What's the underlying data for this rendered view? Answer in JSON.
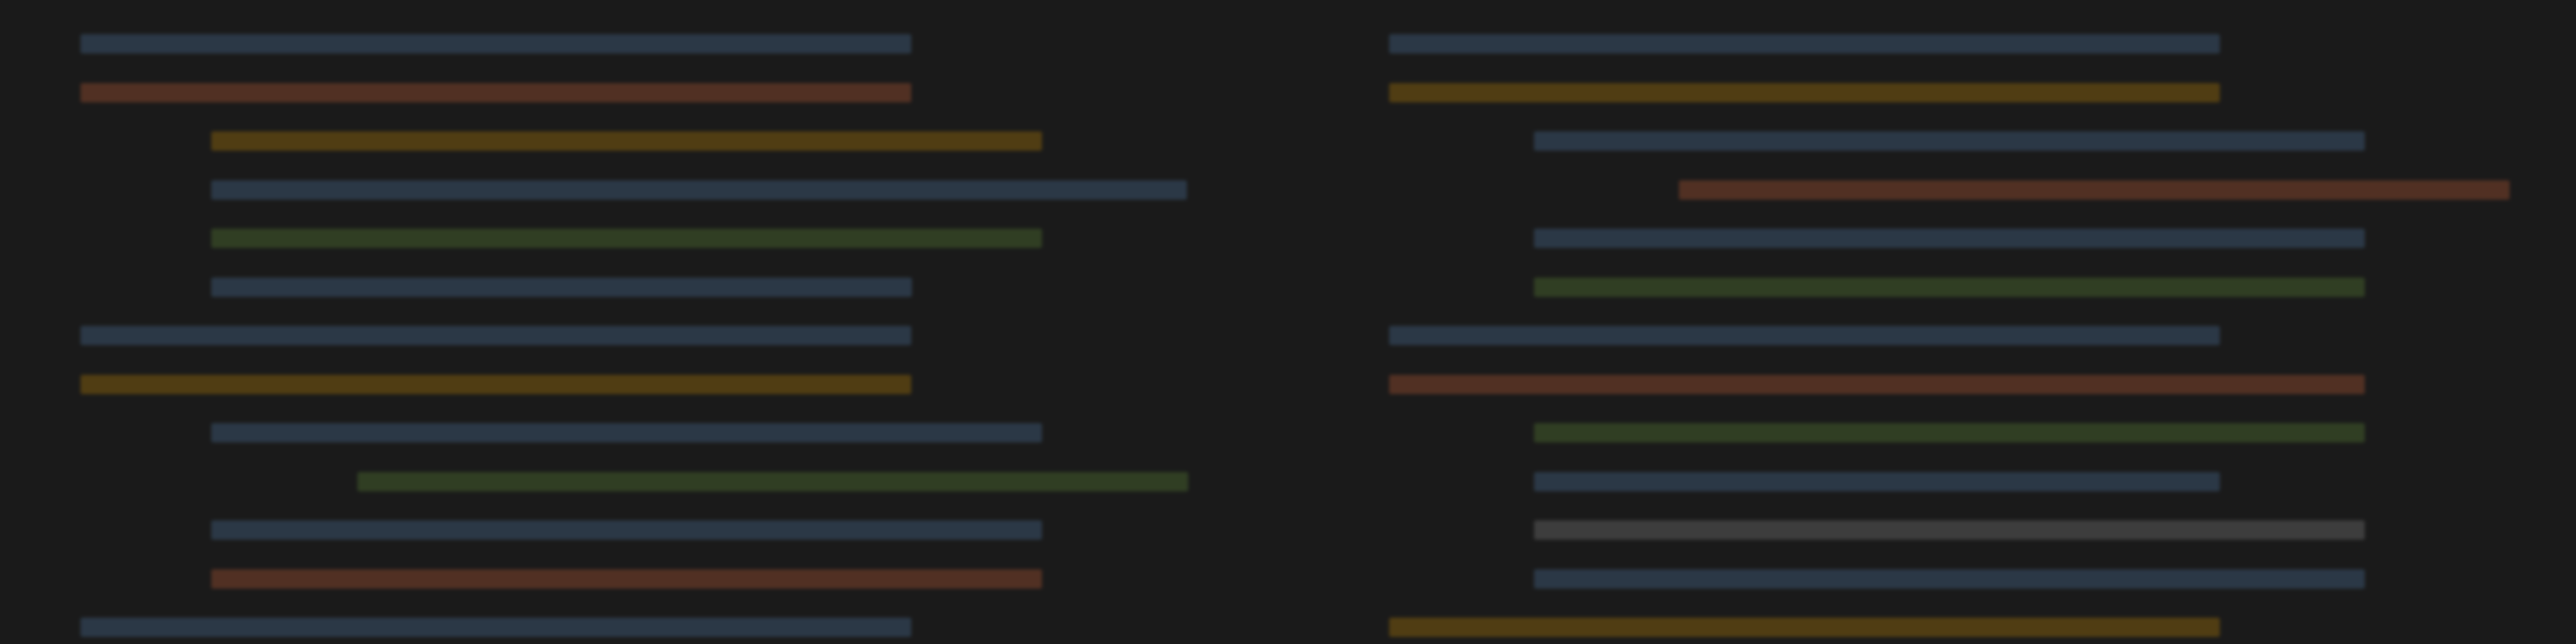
{
  "colors": {
    "background": "#1a1a1a",
    "blue": "#2f3e4f",
    "orange": "#5c3526",
    "yellow": "#5a4413",
    "green": "#354526",
    "gray": "#444444"
  },
  "editor": {
    "panes": [
      {
        "name": "left",
        "lines": [
          {
            "indent": 0,
            "length": 1,
            "color": "blue"
          },
          {
            "indent": 0,
            "length": 1,
            "color": "orange"
          },
          {
            "indent": 1,
            "length": 1,
            "color": "yellow"
          },
          {
            "indent": 1,
            "length": 1,
            "color": "blue"
          },
          {
            "indent": 1,
            "length": 1,
            "color": "green"
          },
          {
            "indent": 1,
            "length": 1,
            "color": "blue"
          },
          {
            "indent": 0,
            "length": 1,
            "color": "blue"
          },
          {
            "indent": 0,
            "length": 1,
            "color": "yellow"
          },
          {
            "indent": 1,
            "length": 1,
            "color": "blue"
          },
          {
            "indent": 2,
            "length": 1,
            "color": "green"
          },
          {
            "indent": 1,
            "length": 1,
            "color": "blue"
          },
          {
            "indent": 1,
            "length": 1,
            "color": "orange"
          },
          {
            "indent": 0,
            "length": 1,
            "color": "blue"
          }
        ]
      },
      {
        "name": "right",
        "lines": [
          {
            "indent": 0,
            "length": 1,
            "color": "blue"
          },
          {
            "indent": 0,
            "length": 1,
            "color": "yellow"
          },
          {
            "indent": 1,
            "length": 1,
            "color": "blue"
          },
          {
            "indent": 2,
            "length": 1,
            "color": "orange"
          },
          {
            "indent": 1,
            "length": 1,
            "color": "blue"
          },
          {
            "indent": 1,
            "length": 1,
            "color": "green"
          },
          {
            "indent": 0,
            "length": 1,
            "color": "blue"
          },
          {
            "indent": 0,
            "length": 1,
            "color": "orange"
          },
          {
            "indent": 1,
            "length": 1,
            "color": "green"
          },
          {
            "indent": 1,
            "length": 1,
            "color": "blue"
          },
          {
            "indent": 1,
            "length": 1,
            "color": "gray"
          },
          {
            "indent": 1,
            "length": 1,
            "color": "blue"
          },
          {
            "indent": 0,
            "length": 1,
            "color": "yellow"
          }
        ]
      }
    ]
  }
}
